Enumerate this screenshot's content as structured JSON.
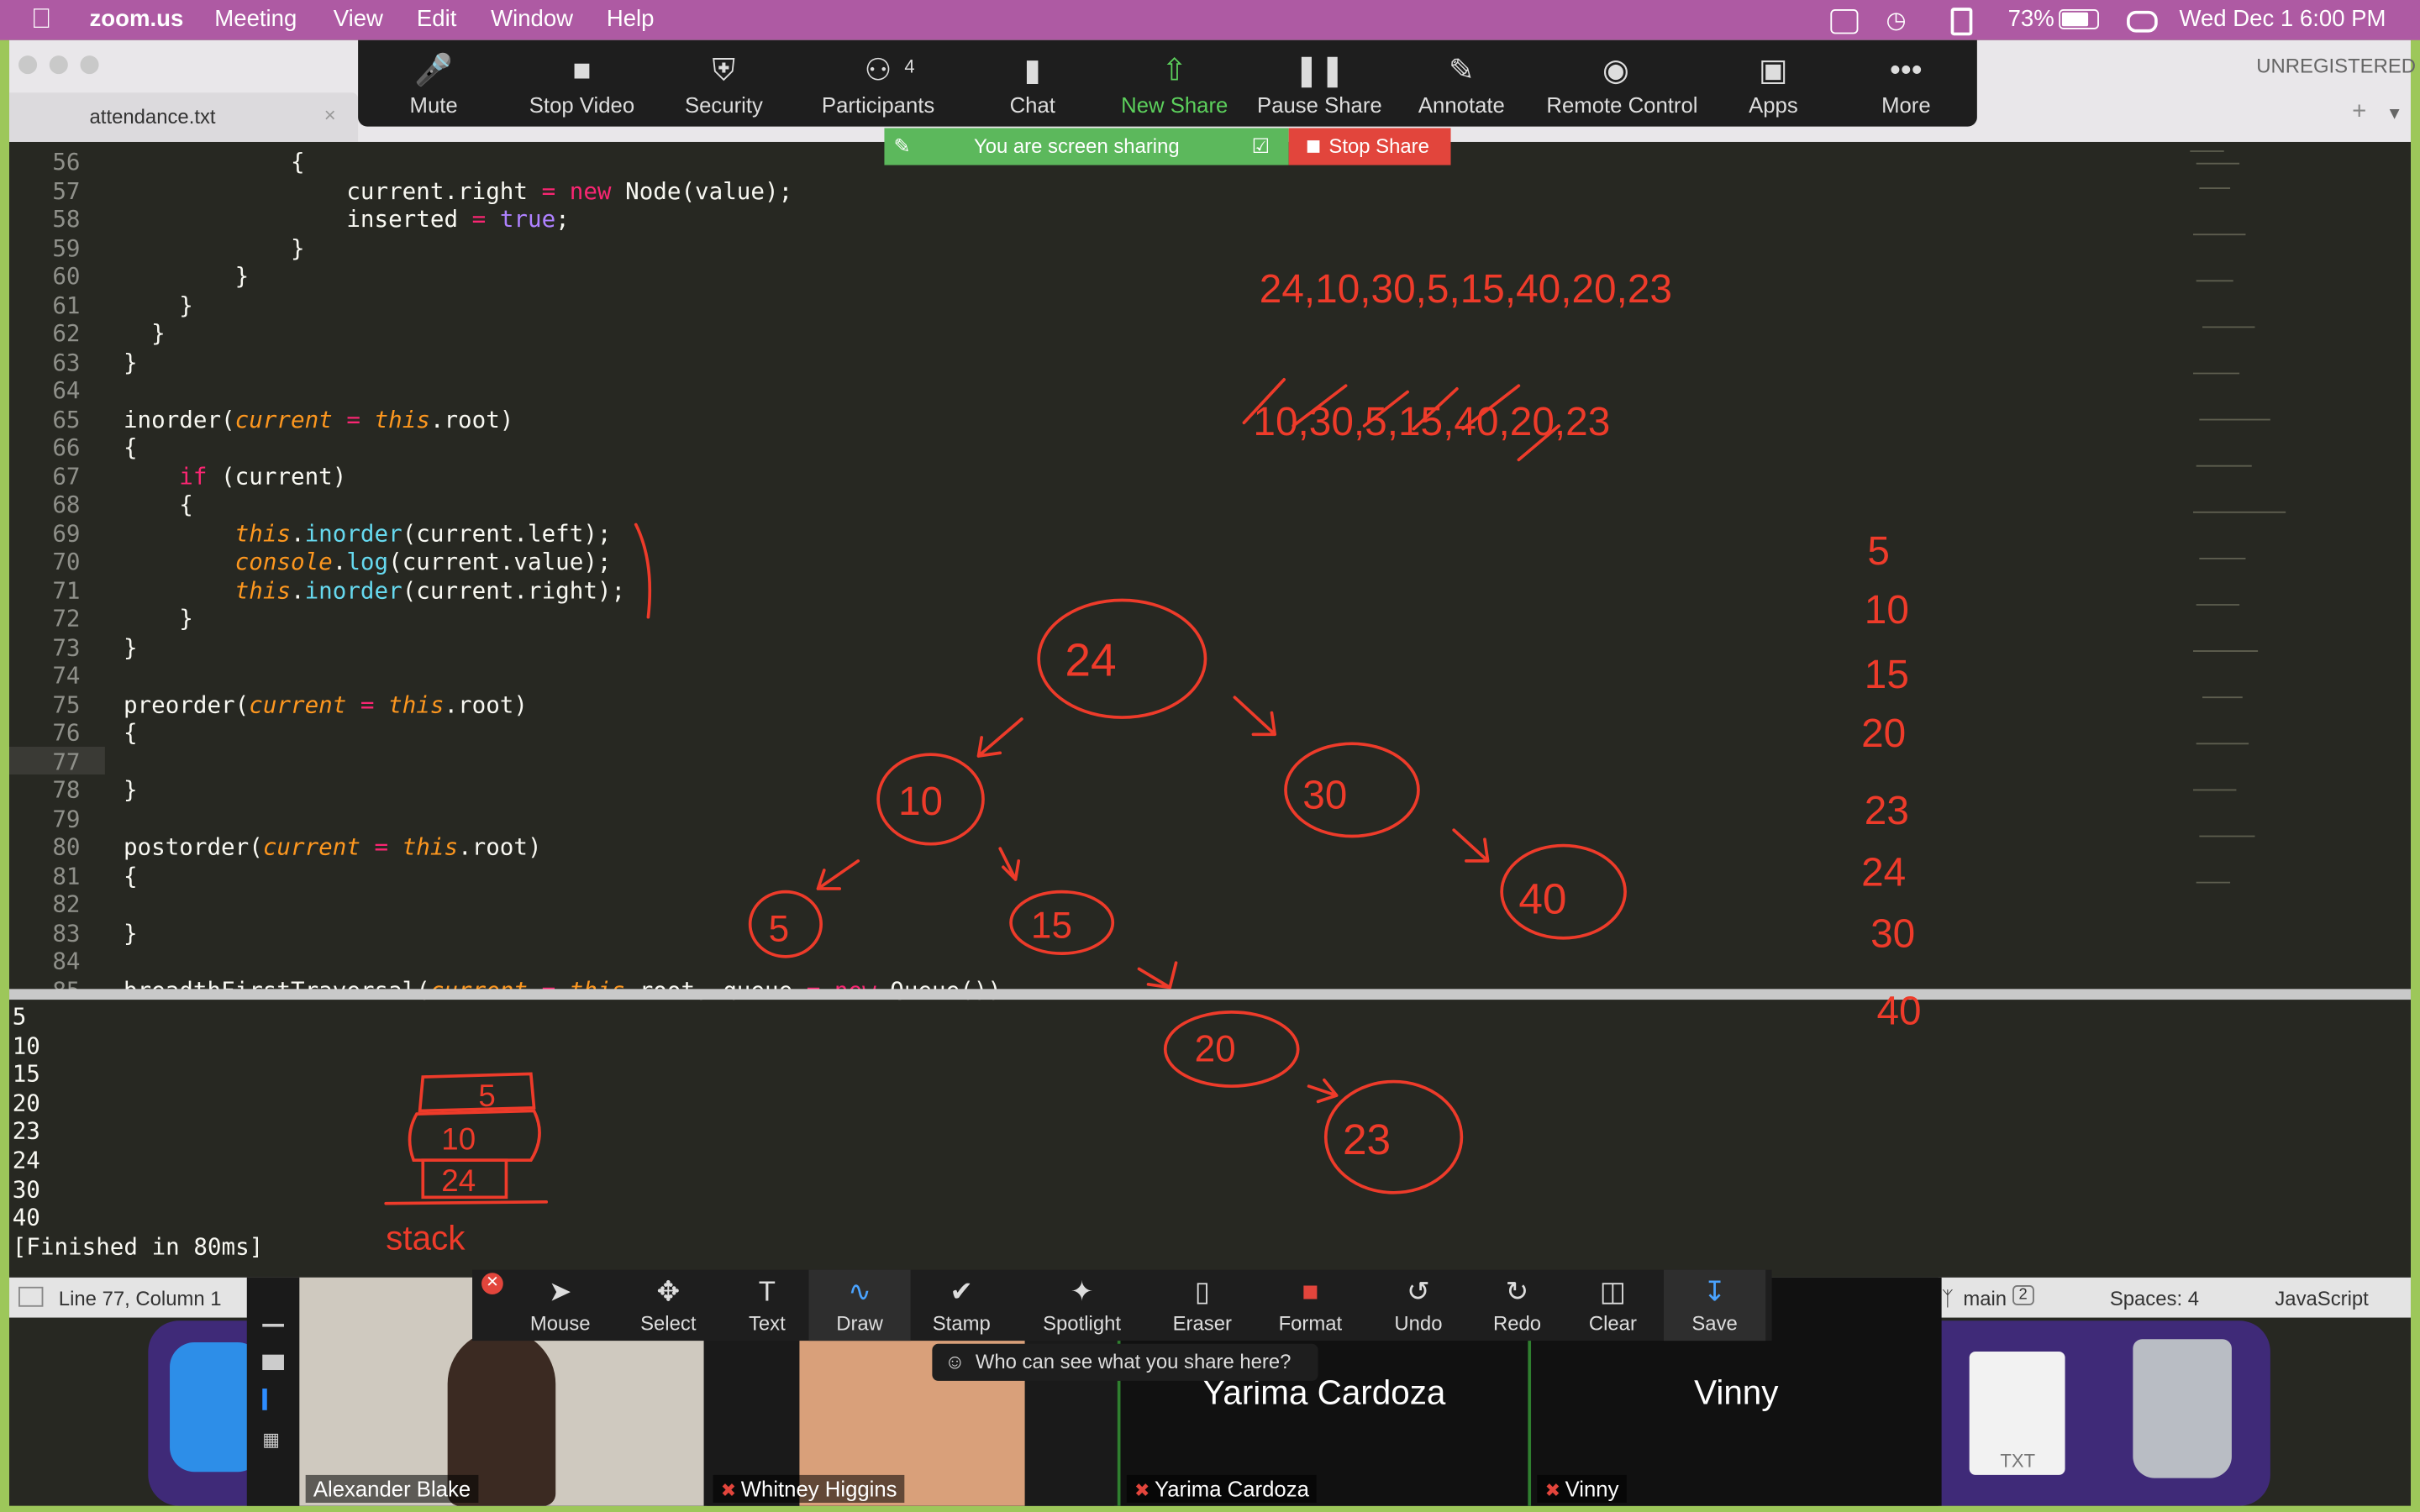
{
  "menubar": {
    "app_name": "zoom.us",
    "menus": [
      "Meeting",
      "View",
      "Edit",
      "Window",
      "Help"
    ],
    "battery": "73%",
    "clock": "Wed Dec 1  6:00 PM"
  },
  "editor": {
    "tab_label": "attendance.txt",
    "unregistered": "UNREGISTERED",
    "code_lines": [
      {
        "n": "56",
        "t": "            {"
      },
      {
        "n": "57",
        "t": "                current.right = new Node(value);"
      },
      {
        "n": "58",
        "t": "                inserted = true;"
      },
      {
        "n": "59",
        "t": "            }"
      },
      {
        "n": "60",
        "t": "        }"
      },
      {
        "n": "61",
        "t": "    }"
      },
      {
        "n": "62",
        "t": "  }"
      },
      {
        "n": "63",
        "t": "}"
      },
      {
        "n": "64",
        "t": ""
      },
      {
        "n": "65",
        "t": "inorder(current = this.root)"
      },
      {
        "n": "66",
        "t": "{"
      },
      {
        "n": "67",
        "t": "    if (current)"
      },
      {
        "n": "68",
        "t": "    {"
      },
      {
        "n": "69",
        "t": "        this.inorder(current.left);"
      },
      {
        "n": "70",
        "t": "        console.log(current.value);"
      },
      {
        "n": "71",
        "t": "        this.inorder(current.right);"
      },
      {
        "n": "72",
        "t": "    }"
      },
      {
        "n": "73",
        "t": "}"
      },
      {
        "n": "74",
        "t": ""
      },
      {
        "n": "75",
        "t": "preorder(current = this.root)"
      },
      {
        "n": "76",
        "t": "{"
      },
      {
        "n": "77",
        "t": ""
      },
      {
        "n": "78",
        "t": "}"
      },
      {
        "n": "79",
        "t": ""
      },
      {
        "n": "80",
        "t": "postorder(current = this.root)"
      },
      {
        "n": "81",
        "t": "{"
      },
      {
        "n": "82",
        "t": ""
      },
      {
        "n": "83",
        "t": "}"
      },
      {
        "n": "84",
        "t": ""
      },
      {
        "n": "85",
        "t": "breadthFirstTraversal(current = this.root, queue = new Queue())"
      }
    ],
    "console_lines": [
      "5",
      "10",
      "15",
      "20",
      "23",
      "24",
      "30",
      "40",
      "[Finished in 80ms]"
    ],
    "status": {
      "position": "Line 77, Column 1",
      "branch": "main",
      "branch_count": "2",
      "spaces": "Spaces: 4",
      "syntax": "JavaScript"
    }
  },
  "zoom_toolbar": {
    "buttons": [
      {
        "label": "Mute",
        "icon": "microphone-icon"
      },
      {
        "label": "Stop Video",
        "icon": "video-camera-icon"
      },
      {
        "label": "Security",
        "icon": "shield-icon"
      },
      {
        "label": "Participants",
        "icon": "participants-icon",
        "count": "4"
      },
      {
        "label": "Chat",
        "icon": "chat-bubble-icon"
      },
      {
        "label": "New Share",
        "icon": "share-arrow-icon"
      },
      {
        "label": "Pause Share",
        "icon": "pause-icon"
      },
      {
        "label": "Annotate",
        "icon": "pencil-icon"
      },
      {
        "label": "Remote Control",
        "icon": "mouse-icon"
      },
      {
        "label": "Apps",
        "icon": "apps-icon"
      },
      {
        "label": "More",
        "icon": "more-dots-icon"
      }
    ],
    "share_status": "You are screen sharing",
    "stop_share": "Stop Share",
    "new_share_color": "#5cd05c",
    "stop_color": "#e2453c"
  },
  "annotation_toolbar": {
    "tools": [
      {
        "label": "Mouse",
        "icon": "cursor-arrow-icon"
      },
      {
        "label": "Select",
        "icon": "move-arrows-icon"
      },
      {
        "label": "Text",
        "icon": "text-t-icon"
      },
      {
        "label": "Draw",
        "icon": "squiggle-icon"
      },
      {
        "label": "Stamp",
        "icon": "checkmark-icon"
      },
      {
        "label": "Spotlight",
        "icon": "spotlight-wand-icon"
      },
      {
        "label": "Eraser",
        "icon": "eraser-icon"
      },
      {
        "label": "Format",
        "icon": "format-color-icon"
      },
      {
        "label": "Undo",
        "icon": "undo-icon"
      },
      {
        "label": "Redo",
        "icon": "redo-icon"
      },
      {
        "label": "Clear",
        "icon": "trash-icon"
      },
      {
        "label": "Save",
        "icon": "save-download-icon"
      }
    ],
    "who_can_see": "Who can see what you share here?"
  },
  "participants": [
    {
      "name": "Alexander Blake",
      "muted": false,
      "video": true
    },
    {
      "name": "Whitney Higgins",
      "muted": true,
      "video": true
    },
    {
      "name": "Yarima Cardoza",
      "muted": true,
      "video": false,
      "display": "Yarima Cardoza"
    },
    {
      "name": "Vinny",
      "muted": true,
      "video": false,
      "display": "Vinny"
    }
  ],
  "annotations": {
    "sequence_top": "24,10,30,5,15,40,20,23",
    "sequence_crossed": "10,30,5,15,40,20,23",
    "tree_nodes": [
      "24",
      "10",
      "30",
      "5",
      "15",
      "40",
      "20",
      "23"
    ],
    "sorted_list": [
      "5",
      "10",
      "15",
      "20",
      "23",
      "24",
      "30",
      "40"
    ],
    "stack_items": [
      "5",
      "10",
      "24"
    ],
    "stack_label": "stack",
    "ink_color": "#ee3b2a"
  },
  "dock": {
    "txt_label": "TXT"
  }
}
